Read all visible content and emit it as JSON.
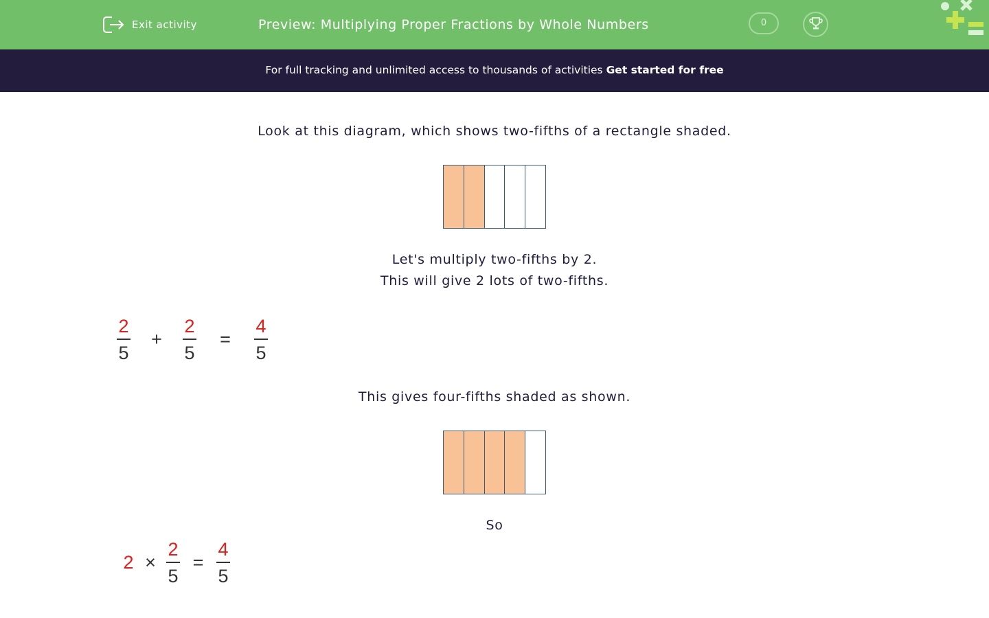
{
  "header": {
    "exit_label": "Exit activity",
    "title": "Preview: Multiplying Proper Fractions by Whole Numbers",
    "score": "0",
    "exit_icon": "exit-icon",
    "trophy_icon": "trophy-icon",
    "logo_icon": "math-symbols-logo"
  },
  "banner": {
    "text": "For full tracking and unlimited access to thousands of activities",
    "cta": "Get started for free"
  },
  "content": {
    "intro": "Look at this diagram, which shows two-fifths of a rectangle shaded.",
    "diagram1": {
      "parts": 5,
      "shaded": 2
    },
    "multiply_line1": "Let's multiply two-fifths by 2.",
    "multiply_line2": "This will give 2 lots of two-fifths.",
    "addition": {
      "a_num": "2",
      "a_den": "5",
      "plus": "+",
      "b_num": "2",
      "b_den": "5",
      "equals": "=",
      "r_num": "4",
      "r_den": "5"
    },
    "result_text": "This gives four-fifths shaded as shown.",
    "diagram2": {
      "parts": 5,
      "shaded": 4
    },
    "so_text": "So",
    "multiplication": {
      "whole": "2",
      "times": "×",
      "f_num": "2",
      "f_den": "5",
      "equals": "=",
      "r_num": "4",
      "r_den": "5"
    }
  },
  "colors": {
    "header_green": "#72bf6a",
    "banner_dark": "#231c3c",
    "shaded_orange": "#f9c196",
    "numerator_red": "#e0201b"
  }
}
